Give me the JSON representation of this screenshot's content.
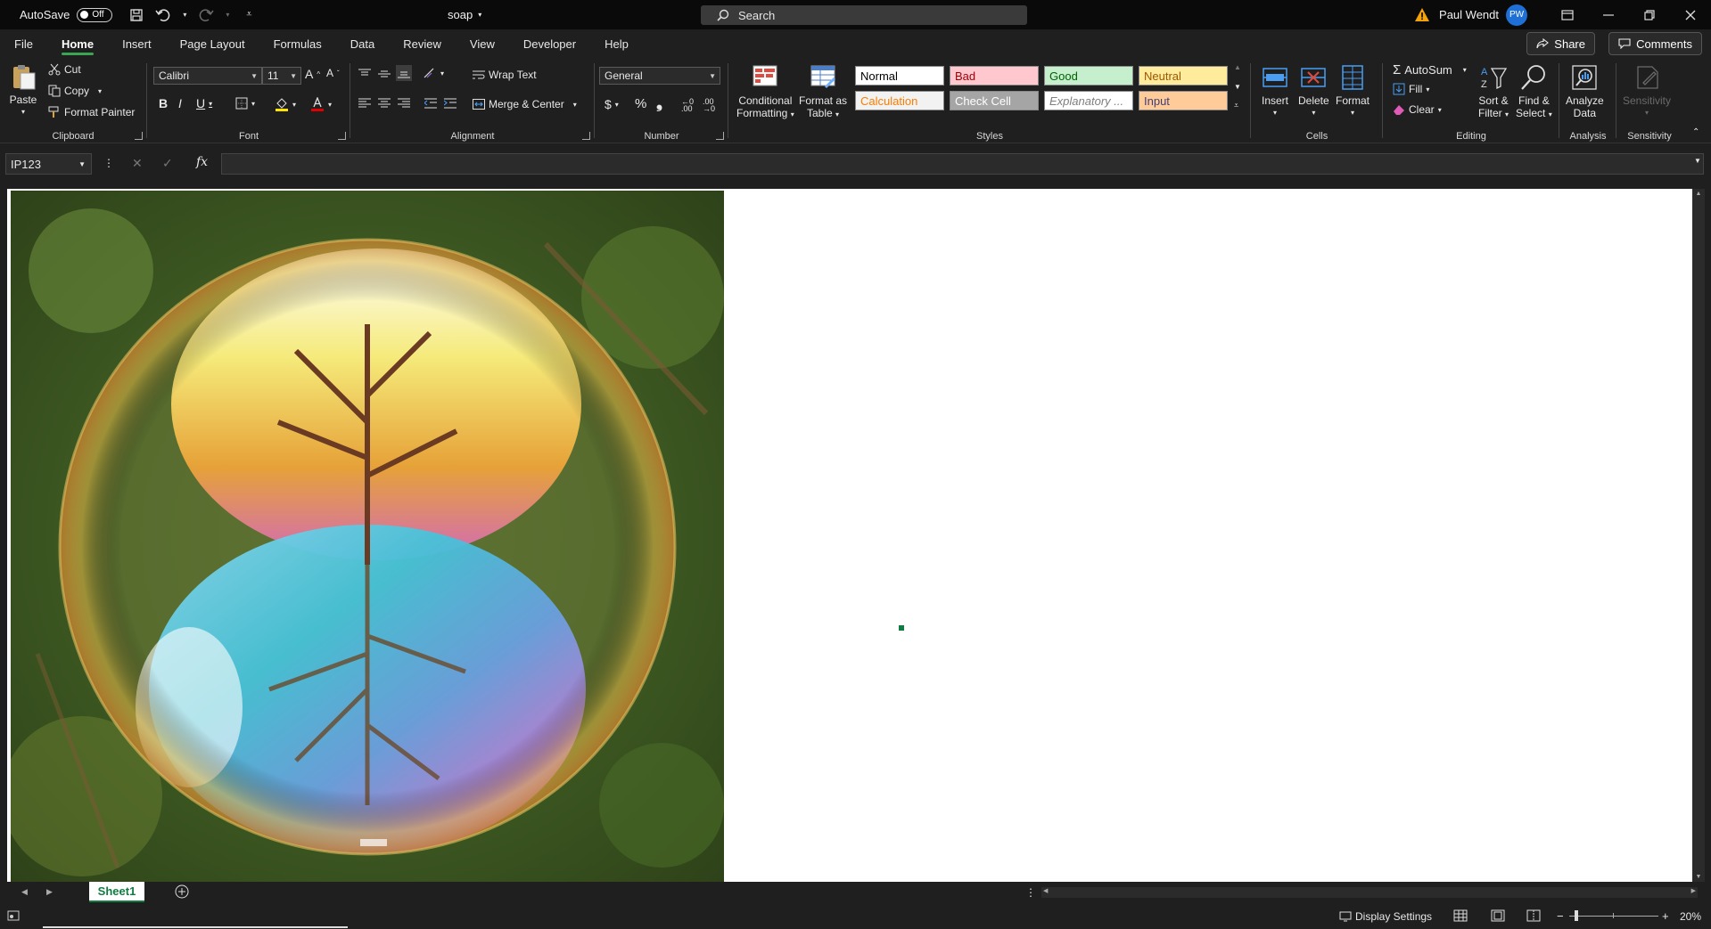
{
  "titlebar": {
    "autosave_label": "AutoSave",
    "autosave_state": "Off",
    "document_title": "soap",
    "search_placeholder": "Search",
    "user_name": "Paul Wendt",
    "user_initials": "PW"
  },
  "tabs": [
    "File",
    "Home",
    "Insert",
    "Page Layout",
    "Formulas",
    "Data",
    "Review",
    "View",
    "Developer",
    "Help"
  ],
  "active_tab": "Home",
  "share_label": "Share",
  "comments_label": "Comments",
  "clipboard": {
    "paste": "Paste",
    "cut": "Cut",
    "copy": "Copy",
    "format_painter": "Format Painter",
    "label": "Clipboard"
  },
  "font": {
    "name": "Calibri",
    "size": "11",
    "label": "Font"
  },
  "alignment": {
    "wrap_text": "Wrap Text",
    "merge_center": "Merge & Center",
    "label": "Alignment"
  },
  "number": {
    "format": "General",
    "label": "Number"
  },
  "styles": {
    "conditional_formatting": [
      "Conditional",
      "Formatting"
    ],
    "format_as_table": [
      "Format as",
      "Table"
    ],
    "cells": [
      {
        "label": "Normal",
        "bg": "#ffffff",
        "fg": "#000000"
      },
      {
        "label": "Bad",
        "bg": "#ffc7ce",
        "fg": "#9c0006"
      },
      {
        "label": "Good",
        "bg": "#c6efce",
        "fg": "#006100"
      },
      {
        "label": "Neutral",
        "bg": "#ffeb9c",
        "fg": "#9c5700"
      },
      {
        "label": "Calculation",
        "bg": "#f2f2f2",
        "fg": "#fa7d00"
      },
      {
        "label": "Check Cell",
        "bg": "#a5a5a5",
        "fg": "#ffffff"
      },
      {
        "label": "Explanatory ...",
        "bg": "#ffffff",
        "fg": "#7f7f7f"
      },
      {
        "label": "Input",
        "bg": "#ffcc99",
        "fg": "#3f3f76"
      }
    ],
    "label": "Styles"
  },
  "cells_group": {
    "insert": "Insert",
    "delete": "Delete",
    "format": "Format",
    "label": "Cells"
  },
  "editing": {
    "autosum": "AutoSum",
    "fill": "Fill",
    "clear": "Clear",
    "sort_filter": [
      "Sort &",
      "Filter"
    ],
    "find_select": [
      "Find &",
      "Select"
    ],
    "label": "Editing"
  },
  "analysis": {
    "analyze_data": [
      "Analyze",
      "Data"
    ],
    "label": "Analysis"
  },
  "sensitivity": {
    "button": "Sensitivity",
    "label": "Sensitivity"
  },
  "formula_bar": {
    "name_box": "IP123",
    "formula": ""
  },
  "sheet_tab": "Sheet1",
  "statusbar": {
    "display_settings": "Display Settings",
    "zoom": "20%"
  },
  "colors": {
    "accent": "#107c41",
    "avatar": "#1e6fd6"
  }
}
